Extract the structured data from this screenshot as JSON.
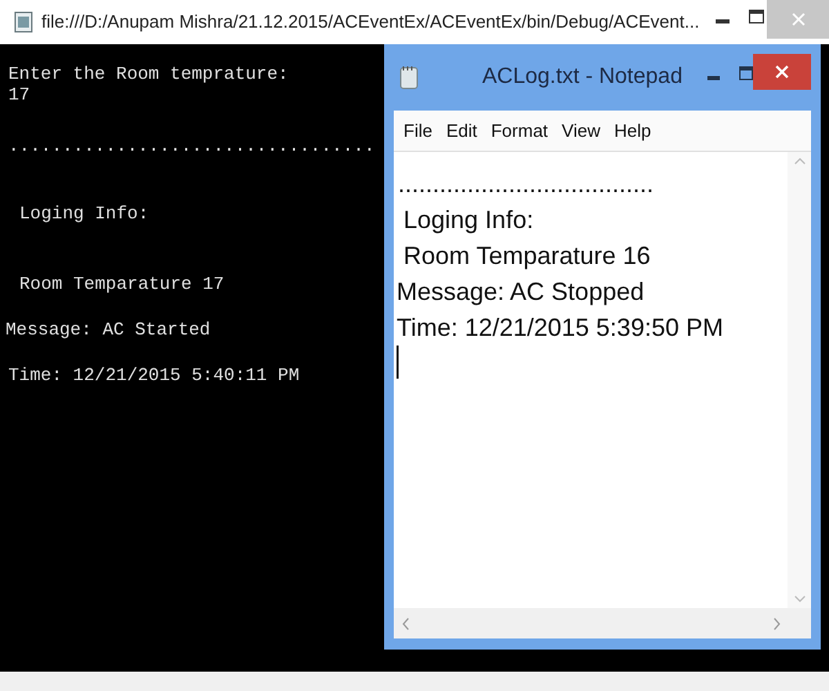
{
  "console": {
    "title": "file:///D:/Anupam Mishra/21.12.2015/ACEventEx/ACEventEx/bin/Debug/ACEvent...",
    "lines": [
      "Enter the Room temprature:",
      "17",
      "..................................",
      "Loging Info:",
      "Room Temparature 17",
      "Message: AC Started",
      "Time: 12/21/2015 5:40:11 PM"
    ]
  },
  "notepad": {
    "title": "ACLog.txt - Notepad",
    "menu": [
      "File",
      "Edit",
      "Format",
      "View",
      "Help"
    ],
    "lines": [
      ".....................................",
      "Loging Info:",
      "Room Temparature 16",
      "Message: AC Stopped",
      "Time: 12/21/2015 5:39:50 PM"
    ]
  }
}
